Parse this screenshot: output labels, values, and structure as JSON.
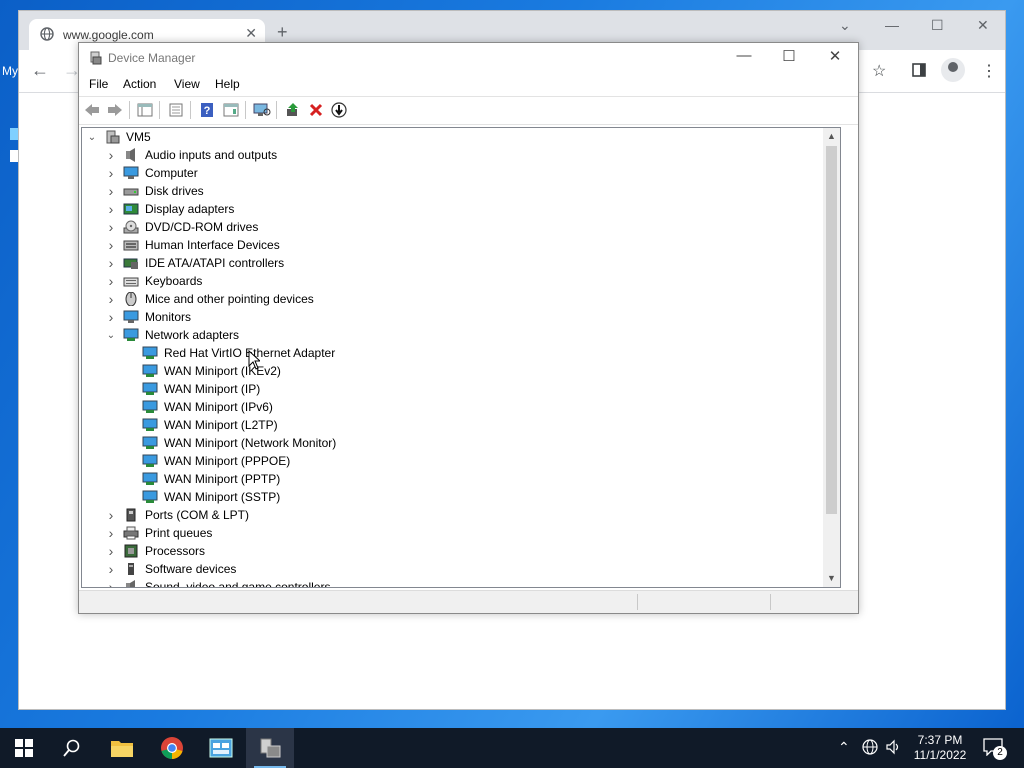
{
  "browser": {
    "tab_title": "www.google.com",
    "new_tab": "+",
    "tab_close": "✕",
    "min": "—",
    "max": "☐",
    "close": "✕",
    "collapse": "⌄",
    "back": "←",
    "forward": "→",
    "star": "☆",
    "menu": "⋮"
  },
  "desktop": {
    "left_text": "My"
  },
  "device_manager": {
    "title": "Device Manager",
    "min": "—",
    "max": "☐",
    "close": "✕",
    "menu": [
      "File",
      "Action",
      "View",
      "Help"
    ],
    "root": "VM5",
    "categories": [
      {
        "label": "Audio inputs and outputs",
        "icon": "speaker-icon"
      },
      {
        "label": "Computer",
        "icon": "computer-icon"
      },
      {
        "label": "Disk drives",
        "icon": "disk-drive-icon"
      },
      {
        "label": "Display adapters",
        "icon": "display-adapter-icon"
      },
      {
        "label": "DVD/CD-ROM drives",
        "icon": "dvd-drive-icon"
      },
      {
        "label": "Human Interface Devices",
        "icon": "hid-icon"
      },
      {
        "label": "IDE ATA/ATAPI controllers",
        "icon": "ide-controller-icon"
      },
      {
        "label": "Keyboards",
        "icon": "keyboard-icon"
      },
      {
        "label": "Mice and other pointing devices",
        "icon": "mouse-icon"
      },
      {
        "label": "Monitors",
        "icon": "monitor-icon"
      },
      {
        "label": "Network adapters",
        "icon": "network-adapter-icon",
        "expanded": true,
        "children": [
          "Red Hat VirtIO Ethernet Adapter",
          "WAN Miniport (IKEv2)",
          "WAN Miniport (IP)",
          "WAN Miniport (IPv6)",
          "WAN Miniport (L2TP)",
          "WAN Miniport (Network Monitor)",
          "WAN Miniport (PPPOE)",
          "WAN Miniport (PPTP)",
          "WAN Miniport (SSTP)"
        ]
      },
      {
        "label": "Ports (COM & LPT)",
        "icon": "port-icon"
      },
      {
        "label": "Print queues",
        "icon": "printer-icon"
      },
      {
        "label": "Processors",
        "icon": "processor-icon"
      },
      {
        "label": "Software devices",
        "icon": "software-device-icon"
      },
      {
        "label": "Sound, video and game controllers",
        "icon": "sound-controller-icon"
      }
    ]
  },
  "taskbar": {
    "time": "7:37 PM",
    "date": "11/1/2022",
    "notification_count": "2"
  }
}
